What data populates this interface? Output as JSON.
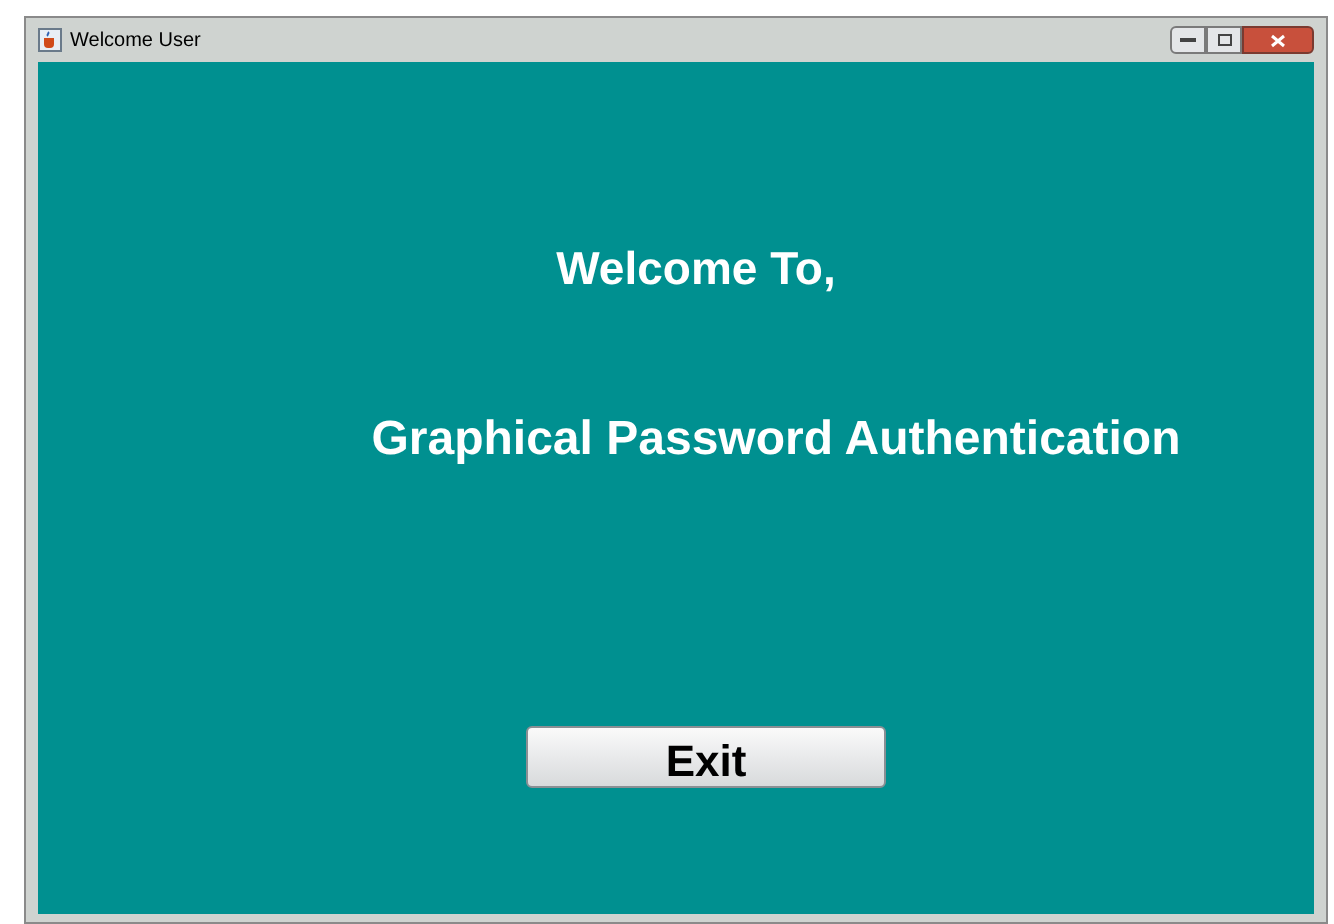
{
  "window": {
    "title": "Welcome User"
  },
  "heading": "Welcome To,",
  "subtitle": "Graphical Password Authentication",
  "buttons": [
    "Exit"
  ]
}
